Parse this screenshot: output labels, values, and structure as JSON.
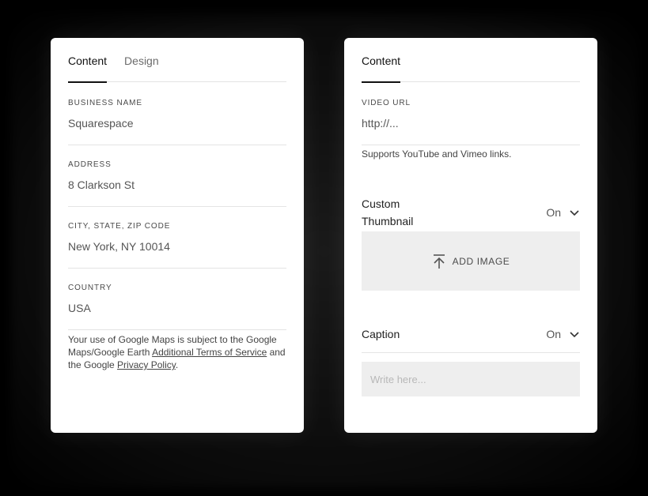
{
  "left_panel": {
    "tabs": [
      {
        "label": "Content",
        "active": true
      },
      {
        "label": "Design",
        "active": false
      }
    ],
    "fields": [
      {
        "label": "BUSINESS NAME",
        "value": "Squarespace"
      },
      {
        "label": "ADDRESS",
        "value": "8 Clarkson St"
      },
      {
        "label": "CITY, STATE, ZIP CODE",
        "value": "New York, NY 10014"
      },
      {
        "label": "COUNTRY",
        "value": "USA"
      }
    ],
    "note": {
      "text1": "Your use of Google Maps is subject to the Google Maps/Google Earth ",
      "link1": "Additional Terms of Service",
      "text2": " and the Google ",
      "link2": "Privacy Policy",
      "text3": "."
    }
  },
  "right_panel": {
    "tabs": [
      {
        "label": "Content",
        "active": true
      }
    ],
    "video_url": {
      "label": "VIDEO URL",
      "value": "http://...",
      "help": "Supports YouTube and Vimeo links."
    },
    "custom_thumbnail": {
      "title_line1": "Custom",
      "title_line2": "Thumbnail",
      "state": "On",
      "add_image_label": "ADD IMAGE"
    },
    "caption": {
      "title": "Caption",
      "state": "On",
      "placeholder": "Write here..."
    }
  },
  "icons": {
    "chevron": "chevron-down-icon",
    "upload": "upload-icon"
  }
}
